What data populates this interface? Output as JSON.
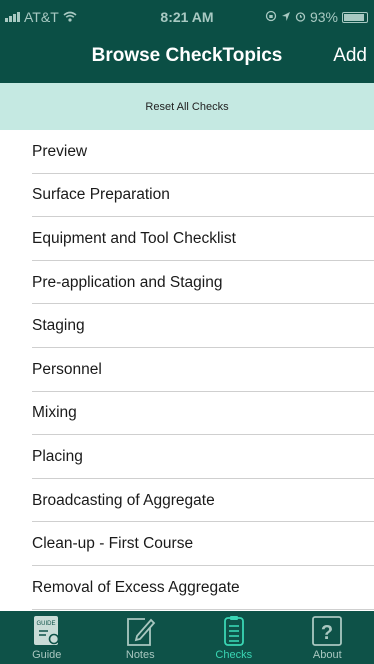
{
  "status_bar": {
    "carrier": "AT&T",
    "time": "8:21 AM",
    "battery": "93%",
    "battery_level": 0.93
  },
  "nav": {
    "title": "Browse CheckTopics",
    "add_label": "Add"
  },
  "reset_label": "Reset All Checks",
  "topics": [
    "Preview",
    "Surface Preparation",
    "Equipment and Tool Checklist",
    "Pre-application and Staging",
    "Staging",
    "Personnel",
    "Mixing",
    "Placing",
    "Broadcasting of Aggregate",
    "Clean-up - First Course",
    "Removal of Excess Aggregate"
  ],
  "tabs": [
    {
      "label": "Guide",
      "icon": "guide-icon",
      "icon_text": "GUIDE",
      "active": false
    },
    {
      "label": "Notes",
      "icon": "notes-icon",
      "active": false
    },
    {
      "label": "Checks",
      "icon": "checks-icon",
      "active": true
    },
    {
      "label": "About",
      "icon": "about-icon",
      "icon_text": "?",
      "active": false
    }
  ],
  "colors": {
    "header_bg": "#0b4f45",
    "reset_bg": "#c5e9e2",
    "tab_active": "#3ad6b4",
    "tab_inactive": "#a9c7c0"
  }
}
